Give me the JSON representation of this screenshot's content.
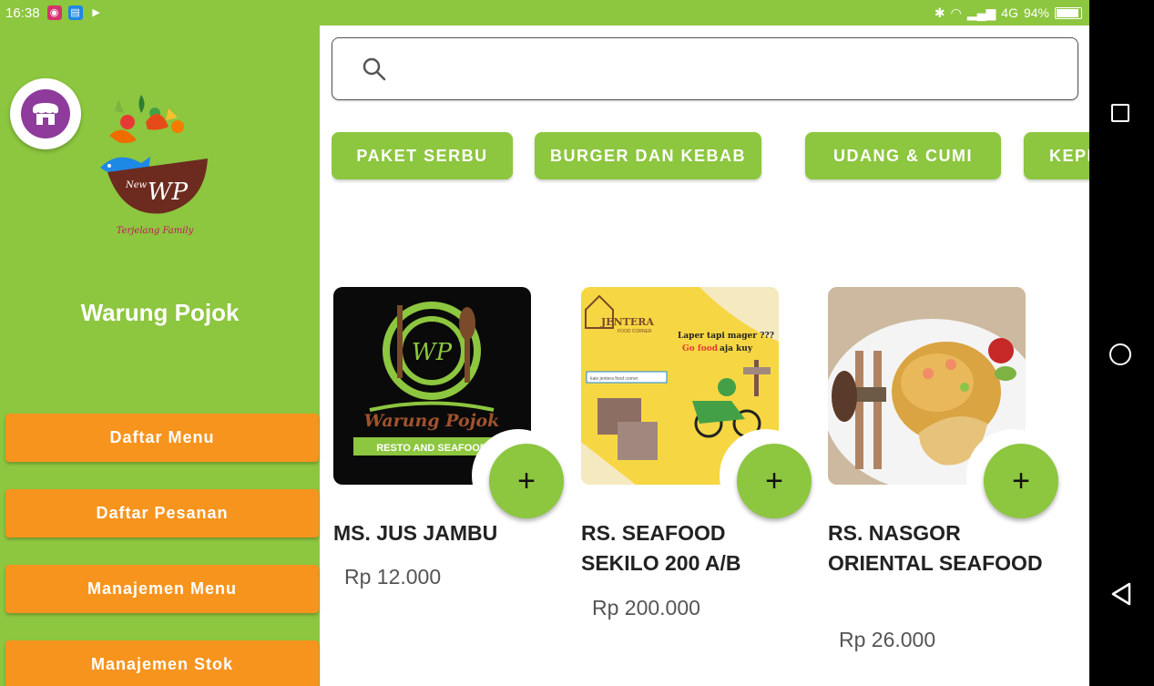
{
  "status_bar": {
    "time": "16:38",
    "network": "4G",
    "battery": "94%",
    "battery_level": 0.94
  },
  "sidebar": {
    "store_name": "Warung Pojok",
    "logo_text": "WP",
    "logo_tag": "New",
    "logo_tagline": "Terjelang Family",
    "menu": [
      {
        "label": "Daftar Menu"
      },
      {
        "label": "Daftar Pesanan"
      },
      {
        "label": "Manajemen Menu"
      },
      {
        "label": "Manajemen Stok"
      }
    ]
  },
  "search": {
    "placeholder": "",
    "value": ""
  },
  "categories": [
    {
      "label": "PAKET SERBU"
    },
    {
      "label": "BURGER DAN KEBAB"
    },
    {
      "label": "UDANG & CUMI"
    },
    {
      "label": "KEPI"
    }
  ],
  "products": [
    {
      "name": "MS. JUS JAMBU",
      "price": "Rp 12.000",
      "image_text": {
        "logo": "WP",
        "brand": "Warung Pojok",
        "ribbon": "RESTO AND SEAFOOD"
      },
      "add_label": "+"
    },
    {
      "name": "RS. SEAFOOD SEKILO 200 A/B",
      "price": "Rp 200.000",
      "image_text": {
        "brand": "JENTERA",
        "sub": "FOOD CORNER",
        "tagline1": "Laper tapi mager ???",
        "tagline2a": "Go food",
        "tagline2b": " aja kuy",
        "search": "kaie jentera food corner"
      },
      "add_label": "+"
    },
    {
      "name": "RS. NASGOR ORIENTAL SEAFOOD",
      "price": "Rp 26.000",
      "add_label": "+"
    }
  ],
  "colors": {
    "primary_green": "#8dc63f",
    "orange": "#f7941d",
    "avatar_purple": "#8e3b9c"
  }
}
